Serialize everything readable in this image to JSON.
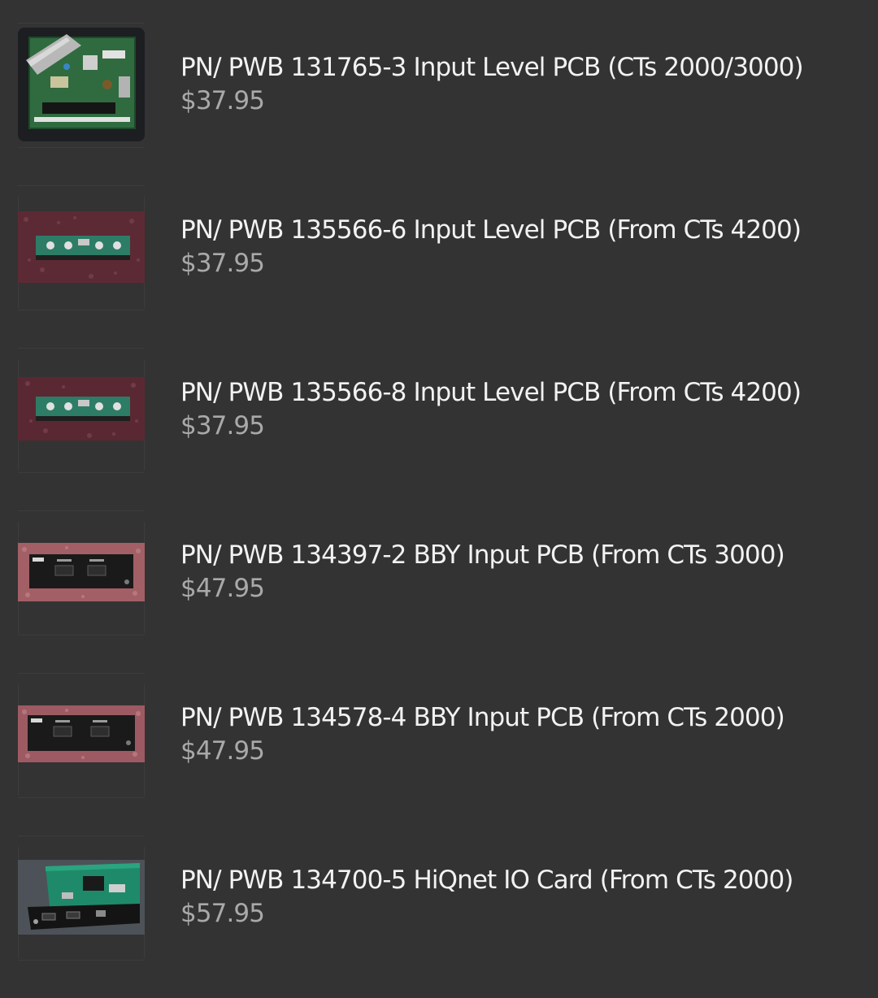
{
  "products": [
    {
      "title": "PN/ PWB 131765-3 Input Level PCB (CTs 2000/3000)",
      "price": "$37.95",
      "image": "pcb-ribbon-board-photo"
    },
    {
      "title": "PN/ PWB 135566-6 Input Level PCB (From CTs 4200)",
      "price": "$37.95",
      "image": "pcb-on-red-foam-photo"
    },
    {
      "title": "PN/ PWB 135566-8 Input Level PCB (From CTs 4200)",
      "price": "$37.95",
      "image": "pcb-on-red-foam-photo"
    },
    {
      "title": "PN/ PWB 134397-2 BBY Input PCB (From CTs 3000)",
      "price": "$47.95",
      "image": "bby-black-panel-photo"
    },
    {
      "title": "PN/ PWB 134578-4 BBY Input PCB (From CTs 2000)",
      "price": "$47.95",
      "image": "bby-black-panel-photo"
    },
    {
      "title": "PN/ PWB 134700-5 HiQnet IO Card (From CTs 2000)",
      "price": "$57.95",
      "image": "hiqnet-card-photo"
    }
  ],
  "colors": {
    "background": "#333333",
    "title": "#f2f2f2",
    "price": "#a9a9a9"
  }
}
